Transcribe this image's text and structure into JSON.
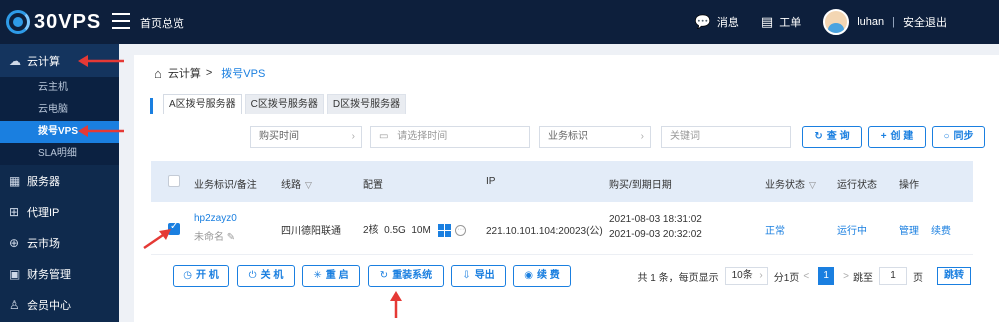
{
  "header": {
    "brand": "30VPS",
    "home_link": "首页总览",
    "messages": "消息",
    "tickets": "工单",
    "username": "luhan",
    "separator": "|",
    "logout": "安全退出"
  },
  "sidebar": {
    "cloud": "云计算",
    "sub": [
      "云主机",
      "云电脑",
      "拨号VPS",
      "SLA明细"
    ],
    "groups": [
      "服务器",
      "代理IP",
      "云市场",
      "财务管理",
      "会员中心"
    ]
  },
  "breadcrumb": {
    "root": "云计算",
    "sep": ">",
    "current": "拨号VPS"
  },
  "tabs": [
    "A区拨号服务器",
    "C区拨号服务器",
    "D区拨号服务器"
  ],
  "filters": {
    "purchase_time": "购买时间",
    "date_placeholder": "请选择时间",
    "business_id": "业务标识",
    "keyword_placeholder": "关键词",
    "query": "查 询",
    "create": "创 建",
    "sync": "同步"
  },
  "table": {
    "headers": [
      "业务标识/备注",
      "线路",
      "配置",
      "IP",
      "购买/到期日期",
      "业务状态",
      "运行状态",
      "操作"
    ],
    "row": {
      "id": "hp2zayz0",
      "remark": "未命名",
      "line": "四川德阳联通",
      "cpu": "2核",
      "mem": "0.5G",
      "bw": "10M",
      "ip": "221.10.101.104:20023(公)",
      "buy_date": "2021-08-03 18:31:02",
      "expire_date": "2021-09-03 20:32:02",
      "biz_status": "正常",
      "run_status": "运行中",
      "manage": "管理",
      "renew": "续费"
    }
  },
  "actions": {
    "start": "开 机",
    "shutdown": "关 机",
    "restart": "重 启",
    "reinstall": "重装系统",
    "export": "导出",
    "renew": "续 费"
  },
  "pager": {
    "summary": "共 1 条，每页显示",
    "per_page": "10条",
    "pages": "分1页",
    "prev": "<",
    "current": "1",
    "next": ">",
    "goto": "跳至",
    "page_input": "1",
    "page_unit": "页",
    "jump": "跳转"
  }
}
